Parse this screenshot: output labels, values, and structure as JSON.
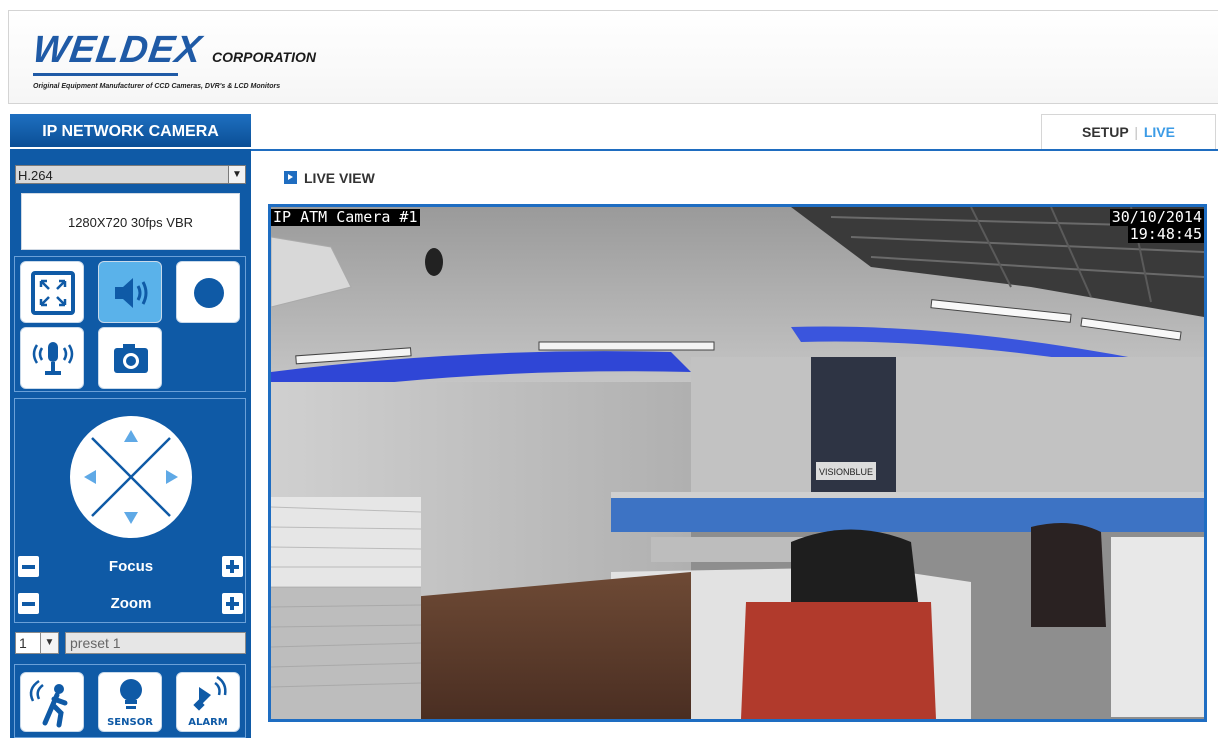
{
  "header": {
    "logo_text": "WELDEX",
    "logo_corp": "CORPORATION",
    "tagline": "Original Equipment Manufacturer of CCD Cameras, DVR's & LCD Monitors"
  },
  "sidebar": {
    "title": "IP NETWORK CAMERA",
    "codec": "H.264",
    "resolution": "1280X720 30fps VBR",
    "focus_label": "Focus",
    "zoom_label": "Zoom",
    "preset_number": "1",
    "preset_placeholder": "preset 1",
    "sensor_label": "SENSOR",
    "alarm_label": "ALARM"
  },
  "tabs": {
    "setup": "SETUP",
    "separator": "|",
    "live": "LIVE"
  },
  "main": {
    "section_title": "LIVE VIEW",
    "osd_camera_name": "IP ATM Camera #1",
    "osd_date": "30/10/2014",
    "osd_time": "19:48:45",
    "scene_sign": "VISIONBLUE"
  },
  "colors": {
    "brand_blue": "#0f5aa6",
    "active_button": "#5ab2ea",
    "live_tab": "#3b9be6"
  }
}
